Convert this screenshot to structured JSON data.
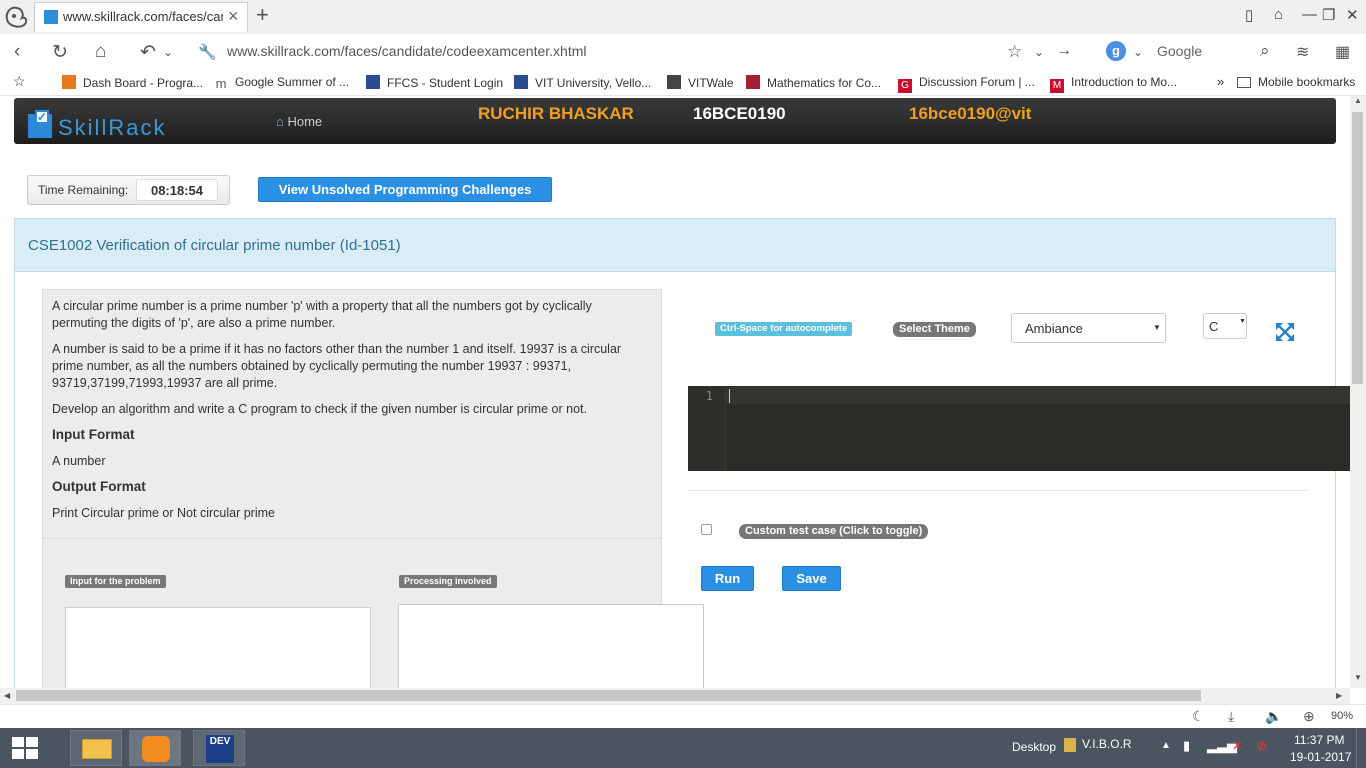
{
  "browser": {
    "tab_title": "www.skillrack.com/faces/can",
    "url": "www.skillrack.com/faces/candidate/codeexamcenter.xhtml",
    "search_engine_letter": "g",
    "search_placeholder": "Google",
    "zoom": "90%"
  },
  "bookmarks": [
    {
      "label": "Dash Board - Progra...",
      "icon": "dashboard-icon",
      "color": "#e87722"
    },
    {
      "label": "Google Summer of ...",
      "icon": "gsoc-icon",
      "color": "#555555",
      "glyph": "m"
    },
    {
      "label": "FFCS - Student Login",
      "icon": "ffcs-icon",
      "color": "#2a4d8f"
    },
    {
      "label": "VIT University, Vello...",
      "icon": "vit-icon",
      "color": "#2a4d8f"
    },
    {
      "label": "VITWale",
      "icon": "vitwale-icon",
      "color": "#444444"
    },
    {
      "label": "Mathematics for Co...",
      "icon": "mit-ocw-icon",
      "color": "#a31f34"
    },
    {
      "label": "Discussion Forum | ...",
      "icon": "forum-icon",
      "color": "#c8102e",
      "glyph": "G"
    },
    {
      "label": "Introduction to Mo...",
      "icon": "intro-icon",
      "color": "#c8102e",
      "glyph": "M"
    }
  ],
  "bookmarks_more": "»",
  "mobile_bookmarks": "Mobile bookmarks",
  "header": {
    "brand": "SkillRack",
    "home": "Home",
    "name": "RUCHIR BHASKAR",
    "reg_no": "16BCE0190",
    "email": "16bce0190@vit"
  },
  "timer": {
    "label": "Time Remaining:",
    "value": "08:18:54"
  },
  "view_unsolved": "View Unsolved Programming Challenges",
  "problem": {
    "title": "CSE1002 Verification of circular prime number (Id-1051)",
    "p1": "A circular prime number is a prime number 'p' with a property that all the numbers got by cyclically permuting the digits of 'p', are also a prime number.",
    "p2": "A number is said to be a prime if it has no factors other than the number 1 and itself. 19937 is a circular prime number, as all the numbers obtained by cyclically permuting the number 19937 : 99371, 93719,37199,71993,19937 are all prime.",
    "p3": "Develop an algorithm and write a C program to check if the given number is circular prime or not.",
    "input_heading": "Input Format",
    "input_text": "A number",
    "output_heading": "Output Format",
    "output_text": "Print Circular prime or Not circular prime",
    "input_label": "Input for the problem",
    "processing_label": "Processing involved"
  },
  "editor": {
    "autocomplete_hint": "Ctrl-Space for autocomplete",
    "select_theme_label": "Select Theme",
    "theme": "Ambiance",
    "language": "C",
    "line_number": "1",
    "custom_test": "Custom test case (Click to toggle)",
    "run": "Run",
    "save": "Save"
  },
  "taskbar": {
    "desktop": "Desktop",
    "vibor": "V.I.B.O.R",
    "time": "11:37 PM",
    "date": "19-01-2017",
    "dev_label": "DEV"
  }
}
